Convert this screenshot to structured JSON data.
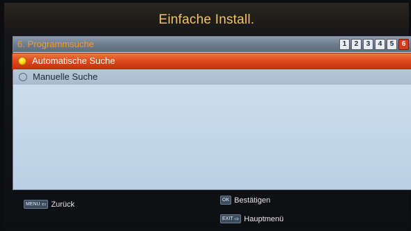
{
  "header": {
    "title": "Einfache Install."
  },
  "panel": {
    "section_title": "6. Programmsuche",
    "steps": [
      "1",
      "2",
      "3",
      "4",
      "5",
      "6"
    ],
    "active_step": "6",
    "options": [
      {
        "label": "Automatische Suche",
        "selected": true
      },
      {
        "label": "Manuelle Suche",
        "selected": false
      }
    ]
  },
  "footer": {
    "back": {
      "key": "MENU",
      "label": "Zurück"
    },
    "ok": {
      "key": "OK",
      "label": "Bestätigen"
    },
    "exit": {
      "key": "EXIT",
      "label": "Hauptmenü"
    }
  },
  "colors": {
    "title": "#f1c36c",
    "section_title": "#f29a2e",
    "selected_row": "#de4a1e",
    "panel_bg": "#c9dceb",
    "active_step": "#d93a1e"
  }
}
